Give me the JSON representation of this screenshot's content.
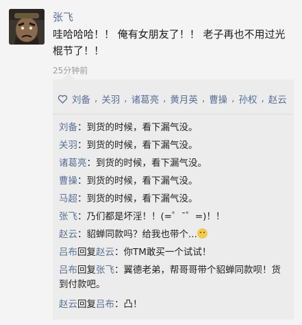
{
  "post": {
    "author": "张飞",
    "text": "哇哈哈哈！！ 俺有女朋友了！！ 老子再也不用过光棍节了！！",
    "time": "25分钟前"
  },
  "likes": [
    "刘备",
    "关羽",
    "诸葛亮",
    "黄月英",
    "曹操",
    "孙权",
    "赵云"
  ],
  "comments": [
    {
      "from": "刘备",
      "to": "",
      "text": "到货的时候，看下漏气没。"
    },
    {
      "from": "关羽",
      "to": "",
      "text": "到货的时候，看下漏气没。"
    },
    {
      "from": "诸葛亮",
      "to": "",
      "text": "到货的时候，看下漏气没。"
    },
    {
      "from": "曹操",
      "to": "",
      "text": "到货的时候，看下漏气没。"
    },
    {
      "from": "马超",
      "to": "",
      "text": "到货的时候，看下漏气没。"
    },
    {
      "from": "张飞",
      "to": "",
      "text": "乃们都是坏淫！！(=゜ˉ゜=)！！"
    },
    {
      "from": "赵云",
      "to": "",
      "text": "貂蝉同款吗？给我也带个..."
    },
    {
      "from": "吕布",
      "to": "赵云",
      "text": "你TM敢买一个试试！"
    },
    {
      "from": "吕布",
      "to": "张飞",
      "text": "翼德老弟，帮哥哥带个貂蝉同款呗！货到付款吧。"
    },
    {
      "from": "赵云",
      "to": "吕布",
      "text": "凸！"
    }
  ],
  "labels": {
    "reply": "回复",
    "colon": "："
  },
  "icons": {
    "like": "heart-outline-icon",
    "emoji": "blushing-emoji-icon"
  },
  "colors": {
    "name": "#5a6f96",
    "panel": "#ececec",
    "background": "#f4f4f4"
  }
}
